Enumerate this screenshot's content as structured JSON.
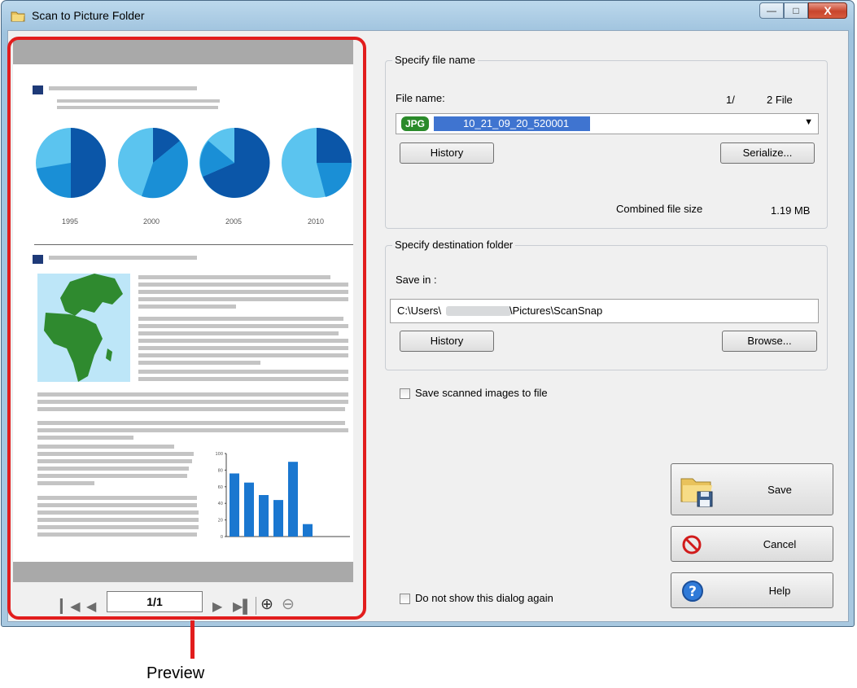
{
  "window": {
    "title": "Scan to Picture Folder"
  },
  "preview": {
    "page_indicator": "1/1",
    "chart_labels": [
      "1995",
      "2000",
      "2005",
      "2010"
    ],
    "bar_axis_ticks": [
      "100",
      "80",
      "60",
      "40",
      "20",
      "0"
    ],
    "bar_values": [
      76,
      65,
      50,
      44,
      90,
      15
    ]
  },
  "file_name_group": {
    "title": "Specify file name",
    "file_name_label": "File name:",
    "file_count_page": "1/",
    "file_count_total": "2 File",
    "file_type_badge": "JPG",
    "file_name_value": "10_21_09_20_520001",
    "history_label": "History",
    "serialize_label": "Serialize...",
    "combined_size_label": "Combined file size",
    "combined_size_value": "1.19 MB"
  },
  "destination_group": {
    "title": "Specify destination folder",
    "save_in_label": "Save in :",
    "path_prefix": "C:\\Users\\",
    "path_suffix": "\\Pictures\\ScanSnap",
    "history_label": "History",
    "browse_label": "Browse..."
  },
  "options": {
    "save_scanned_label": "Save scanned images to file",
    "do_not_show_label": "Do not show this dialog again"
  },
  "actions": {
    "save_label": "Save",
    "cancel_label": "Cancel",
    "help_label": "Help"
  },
  "callout": {
    "text": "Preview"
  },
  "colors": {
    "highlight": "#e21d1d",
    "pie_dark": "#0b56a8",
    "pie_light": "#5bc4ef",
    "bar": "#1a77d0",
    "map_green": "#2f8a2f"
  }
}
